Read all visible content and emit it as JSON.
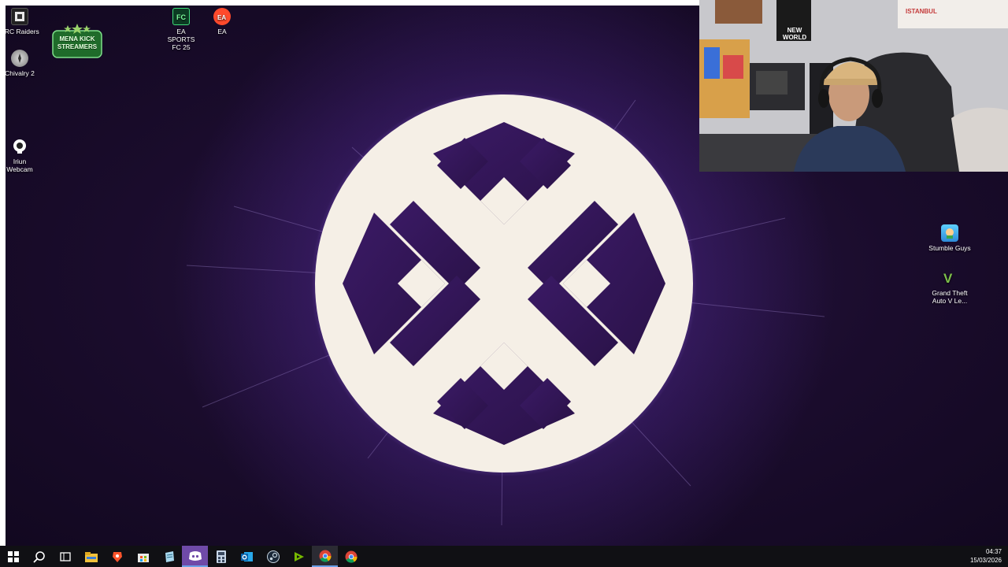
{
  "desktop_icons": [
    {
      "label": "ARC Raiders",
      "icon": "arc-raiders-icon"
    },
    {
      "label": "Chivalry 2",
      "icon": "chivalry-icon"
    },
    {
      "label": "Iriun Webcam",
      "icon": "webcam-icon"
    },
    {
      "label": "EA SPORTS FC 25",
      "icon": "ea-fc-icon"
    },
    {
      "label": "EA",
      "icon": "ea-icon"
    },
    {
      "label": "Stumble Guys",
      "icon": "stumble-guys-icon"
    },
    {
      "label": "Grand Theft Auto V Le...",
      "icon": "gta-icon"
    }
  ],
  "overlay": {
    "badge_text": "MENA KICK STREAMERS",
    "webcam_poster_text": "NEW WORLD",
    "webcam_sign_text": "ISTANBUL"
  },
  "taskbar": {
    "time": "04:37",
    "date": "15/03/2026",
    "apps": [
      "start",
      "search",
      "task-view",
      "file-explorer",
      "brave",
      "store",
      "notepad",
      "discord",
      "calculator",
      "outlook",
      "steam",
      "nvidia",
      "chrome",
      "chrome-2"
    ]
  },
  "colors": {
    "wallpaper_dark": "#1a0c2c",
    "logo_purple": "#3d1a5e",
    "logo_cream": "#f5efe6",
    "taskbar": "#101014",
    "badge_green": "#2f8a3a"
  }
}
